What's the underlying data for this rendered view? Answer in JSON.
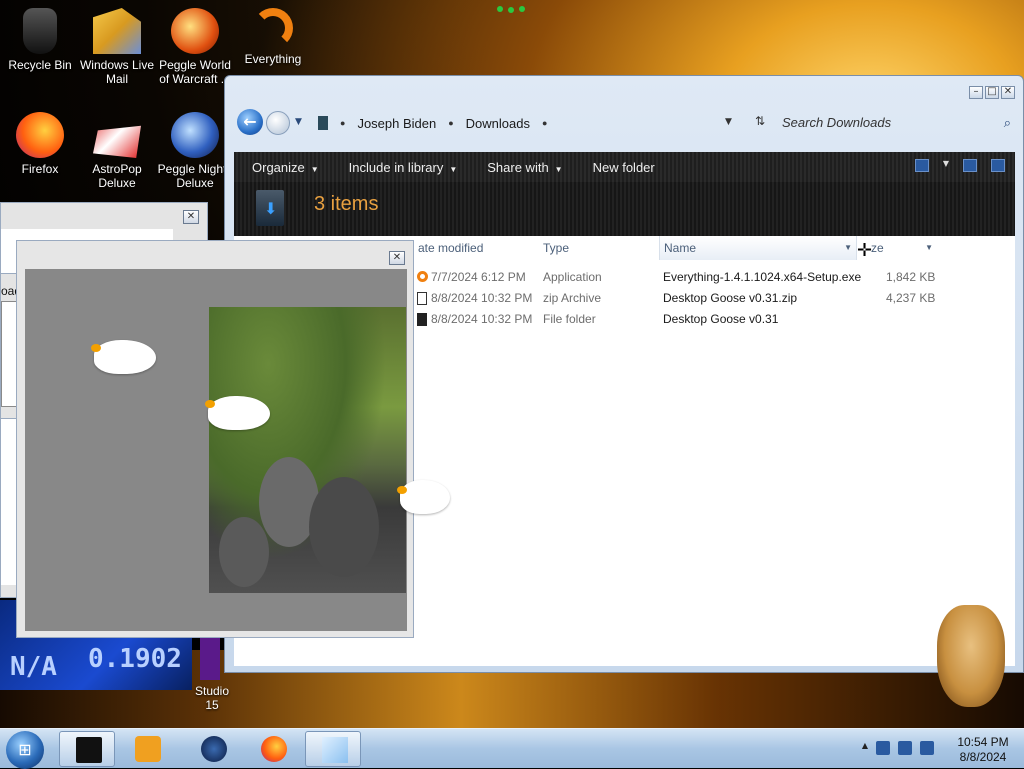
{
  "desktop": {
    "icons": [
      {
        "label_line1": "Recycle Bin",
        "label_line2": "",
        "icon": "recycle-bin-icon"
      },
      {
        "label_line1": "Windows Live",
        "label_line2": "Mail",
        "icon": "windows-live-mail-icon"
      },
      {
        "label_line1": "Peggle World",
        "label_line2": "of Warcraft ...",
        "icon": "peggle-world-icon"
      },
      {
        "label_line1": "Everything",
        "label_line2": "",
        "icon": "everything-icon"
      },
      {
        "label_line1": "Firefox",
        "label_line2": "",
        "icon": "firefox-icon"
      },
      {
        "label_line1": "AstroPop",
        "label_line2": "Deluxe",
        "icon": "astropop-icon"
      },
      {
        "label_line1": "Peggle Nights",
        "label_line2": "Deluxe",
        "icon": "peggle-nights-icon"
      },
      {
        "label_line1": "Studio",
        "label_line2": "15",
        "icon": "studio-icon"
      }
    ],
    "stock_text_1": "N/A",
    "stock_text_2": "0.1902"
  },
  "explorer": {
    "breadcrumb": [
      "Joseph Biden",
      "Downloads"
    ],
    "search_placeholder": "Search Downloads",
    "toolbar": {
      "organize": "Organize",
      "include_in_library": "Include in library",
      "share_with": "Share with",
      "new_folder": "New folder"
    },
    "item_count": "3 items",
    "columns": {
      "date_modified": "ate modified",
      "type": "Type",
      "name": "Name",
      "size": "ze"
    },
    "files": [
      {
        "date": "7/7/2024 6:12 PM",
        "type": "Application",
        "name": "Everything-1.4.1.1024.x64-Setup.exe",
        "size": "1,842 KB",
        "icon": "application-icon"
      },
      {
        "date": "8/8/2024 10:32 PM",
        "type": "zip Archive",
        "name": "Desktop Goose v0.31.zip",
        "size": "4,237 KB",
        "icon": "zip-icon"
      },
      {
        "date": "8/8/2024 10:32 PM",
        "type": "File folder",
        "name": "Desktop Goose v0.31",
        "size": "",
        "icon": "folder-icon"
      }
    ]
  },
  "goose_windows": {
    "small_title": "oad\""
  },
  "taskbar": {
    "time": "10:54 PM",
    "date": "8/8/2024"
  }
}
